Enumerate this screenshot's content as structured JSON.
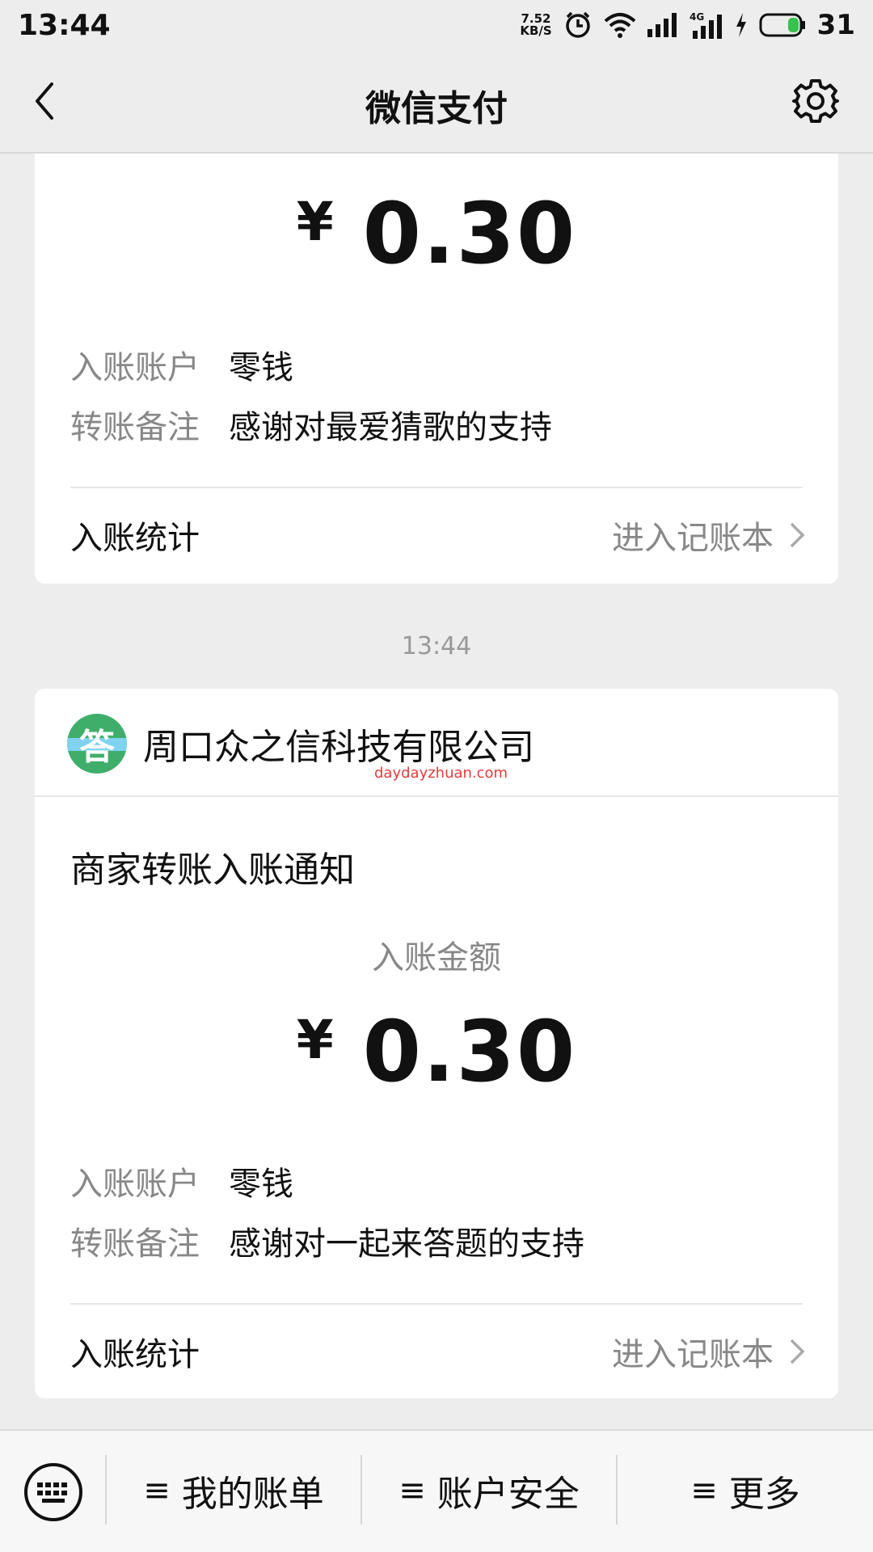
{
  "status_bar": {
    "time": "13:44",
    "speed_top": "7.52",
    "speed_bottom": "KB/S",
    "network": "4G",
    "battery": "31"
  },
  "nav": {
    "title": "微信支付",
    "back_icon": "chevron-left-icon",
    "settings_icon": "gear-icon"
  },
  "card1": {
    "currency": "¥",
    "amount": "0.30",
    "account_label": "入账账户",
    "account_value": "零钱",
    "remark_label": "转账备注",
    "remark_value": "感谢对最爱猜歌的支持",
    "stats_label": "入账统计",
    "stats_link": "进入记账本"
  },
  "timestamp": "13:44",
  "card2": {
    "merchant_logo_char": "答",
    "merchant_name": "周口众之信科技有限公司",
    "watermark": "daydayzhuan.com",
    "notice_title": "商家转账入账通知",
    "amount_label": "入账金额",
    "currency": "¥",
    "amount": "0.30",
    "account_label": "入账账户",
    "account_value": "零钱",
    "remark_label": "转账备注",
    "remark_value": "感谢对一起来答题的支持",
    "stats_label": "入账统计",
    "stats_link": "进入记账本"
  },
  "bottom_bar": {
    "menu_glyph": "≡",
    "items": [
      {
        "label": "我的账单"
      },
      {
        "label": "账户安全"
      },
      {
        "label": "更多"
      }
    ]
  },
  "colors": {
    "background": "#ededed",
    "card": "#ffffff",
    "muted_text": "#888888",
    "watermark": "#e23b3b",
    "logo_green": "#3fae6a"
  }
}
